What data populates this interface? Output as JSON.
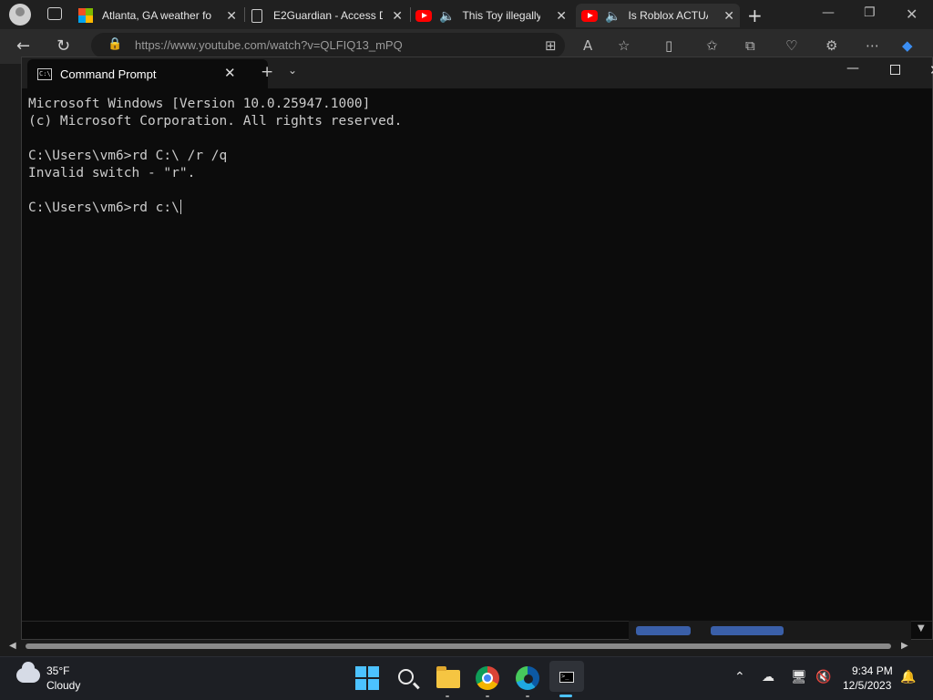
{
  "browser": {
    "tabs": [
      {
        "title": "Atlanta, GA weather fo"
      },
      {
        "title": "E2Guardian - Access D"
      },
      {
        "title": "This Toy illegally"
      },
      {
        "title": "Is Roblox ACTUAL"
      }
    ],
    "address": "https://www.youtube.com/watch?v=QLFIQ13_mPQ"
  },
  "terminal": {
    "tab_title": "Command Prompt",
    "lines": [
      "Microsoft Windows [Version 10.0.25947.1000]",
      "(c) Microsoft Corporation. All rights reserved.",
      "",
      "C:\\Users\\vm6>rd C:\\ /r /q",
      "Invalid switch - \"r\".",
      "",
      "C:\\Users\\vm6>rd c:\\"
    ]
  },
  "taskbar": {
    "weather_temp": "35°F",
    "weather_cond": "Cloudy",
    "time": "9:34 PM",
    "date": "12/5/2023"
  },
  "colors": {
    "accent": "#4cc2ff",
    "terminal_bg": "#0c0c0c",
    "terminal_text": "#cccccc"
  }
}
